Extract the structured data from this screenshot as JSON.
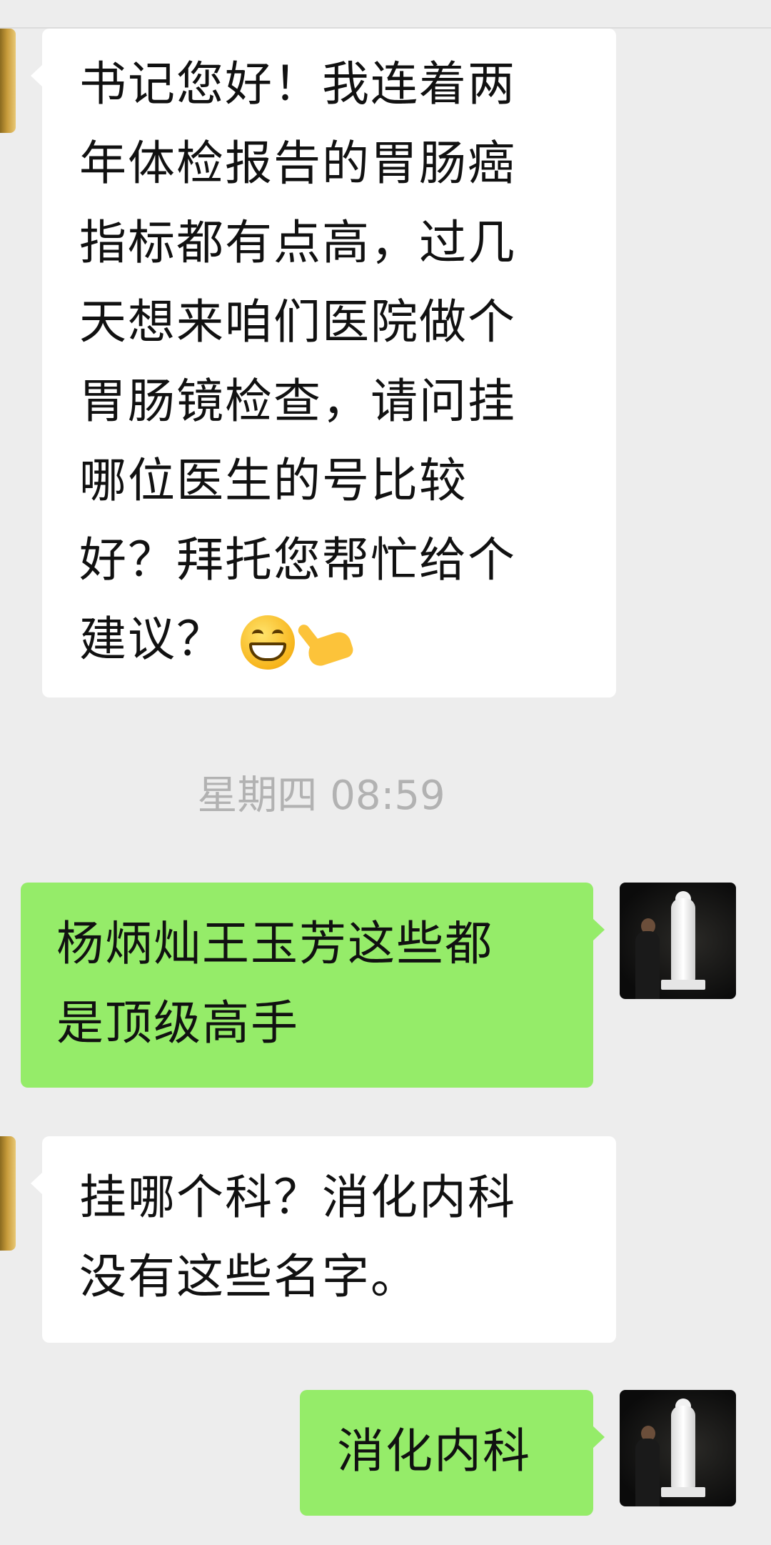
{
  "messages": [
    {
      "direction": "incoming",
      "lines": [
        "书记您好！我连着两",
        "年体检报告的胃肠癌",
        "指标都有点高，过几",
        "天想来咱们医院做个",
        "胃肠镜检查，请问挂",
        "哪位医生的号比较",
        "好？拜托您帮忙给个",
        "建议？"
      ],
      "emojis": [
        "grinning-face-emoji",
        "ok-hand-emoji"
      ]
    },
    {
      "direction": "outgoing",
      "lines": [
        "杨炳灿王玉芳这些都",
        "是顶级高手"
      ]
    },
    {
      "direction": "incoming",
      "lines": [
        "挂哪个科？消化内科",
        "没有这些名字。"
      ]
    },
    {
      "direction": "outgoing",
      "lines": [
        "消化内科"
      ]
    }
  ],
  "timestamp": "星期四 08:59",
  "colors": {
    "background": "#ededed",
    "incoming_bubble": "#ffffff",
    "outgoing_bubble": "#95ec69",
    "timestamp_text": "#b2b2b2"
  }
}
